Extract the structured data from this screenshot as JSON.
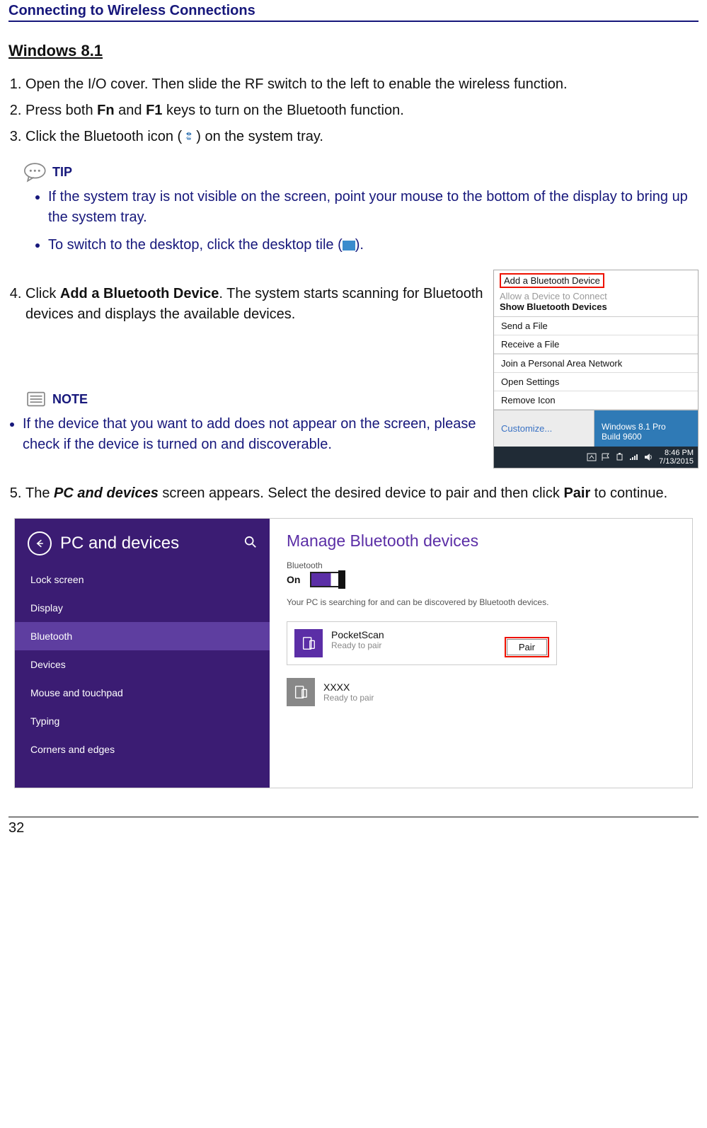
{
  "header": "Connecting to Wireless Connections",
  "section": "Windows 8.1",
  "steps": {
    "s1": "Open the I/O cover. Then slide the RF switch to the left to enable the wireless function.",
    "s2_pre": "Press both ",
    "s2_fn": "Fn",
    "s2_mid": " and ",
    "s2_f1": "F1",
    "s2_post": " keys to turn on the Bluetooth function.",
    "s3_pre": "Click the Bluetooth icon (",
    "s3_post": ") on the system tray.",
    "s4_pre": "Click ",
    "s4_bold": "Add a Bluetooth Device",
    "s4_post": ". The system starts scanning for Bluetooth devices and displays the available devices.",
    "s5_pre": "The ",
    "s5_italic": "PC and devices",
    "s5_mid": " screen appears. Select the desired device to pair and then click ",
    "s5_bold": "Pair",
    "s5_post": " to continue."
  },
  "tip": {
    "label": "TIP",
    "items": [
      "If the system tray is not visible on the screen, point your mouse to the bottom of the display to bring up the system tray.",
      "To switch to the desktop, click the desktop tile ("
    ],
    "item2_post": ")."
  },
  "note": {
    "label": "NOTE",
    "item": "If the device that you want to add does not appear on the screen, please check if the device is turned on and discoverable."
  },
  "tray": {
    "add": "Add a Bluetooth Device",
    "allow": "Allow a Device to Connect",
    "show": "Show Bluetooth Devices",
    "send": "Send a File",
    "recv": "Receive a File",
    "join": "Join a Personal Area Network",
    "open": "Open Settings",
    "remove": "Remove Icon",
    "customize": "Customize...",
    "winline1": "Windows 8.1 Pro",
    "winline2": "Build 9600",
    "time1": "8:46 PM",
    "time2": "7/13/2015"
  },
  "pc": {
    "title": "PC and devices",
    "menu": [
      "Lock screen",
      "Display",
      "Bluetooth",
      "Devices",
      "Mouse and touchpad",
      "Typing",
      "Corners and edges"
    ],
    "right_title": "Manage Bluetooth devices",
    "bt_label": "Bluetooth",
    "on": "On",
    "searching": "Your PC is searching for and can be discovered by Bluetooth devices.",
    "dev1_name": "PocketScan",
    "dev1_stat": "Ready to pair",
    "pair": "Pair",
    "dev2_name": "XXXX",
    "dev2_stat": "Ready to pair"
  },
  "page_number": "32"
}
